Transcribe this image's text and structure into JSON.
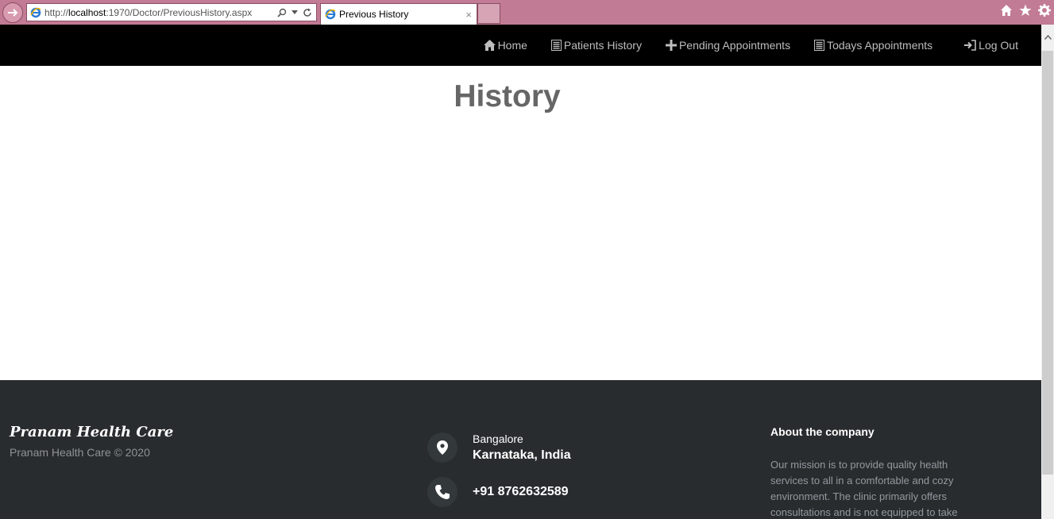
{
  "browser": {
    "url_prefix": "http://",
    "url_host": "localhost",
    "url_rest": ":1970/Doctor/PreviousHistory.aspx",
    "tab_title": "Previous History",
    "tab_close": "×"
  },
  "nav": {
    "home": "Home",
    "patients_history": "Patients History",
    "pending_appointments": "Pending Appointments",
    "todays_appointments": "Todays Appointments",
    "logout": "Log Out"
  },
  "main": {
    "title": "History"
  },
  "footer": {
    "brand": "Pranam Health Care",
    "copyright": "Pranam Health Care © 2020",
    "city": "Bangalore",
    "state": "Karnataka, India",
    "phone": "+91 8762632589",
    "about_title": "About the company",
    "about_text": "Our mission is to provide quality health services to all in a comfortable and cozy environment. The clinic primarily offers consultations and is not equipped to take"
  },
  "colors": {
    "chrome": "#c27b94",
    "navbar": "#000000",
    "footer": "#292c2f",
    "title": "#666666"
  }
}
